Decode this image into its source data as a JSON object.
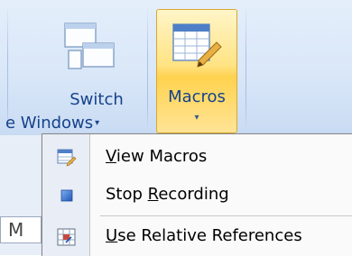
{
  "ribbon": {
    "switch_windows": {
      "line1": "Switch",
      "line2": "e Windows",
      "arrow": "▾"
    },
    "macros": {
      "label": "Macros",
      "arrow": "▾"
    }
  },
  "left_fragment": {
    "text": "M"
  },
  "menu": {
    "items": [
      {
        "pre": "",
        "mnemonic": "V",
        "post": "iew Macros",
        "icon": "view-macros-icon"
      },
      {
        "pre": "Stop ",
        "mnemonic": "R",
        "post": "ecording",
        "icon": "stop-recording-icon"
      },
      {
        "pre": "",
        "mnemonic": "U",
        "post": "se Relative References",
        "icon": "relative-references-icon"
      }
    ]
  },
  "colors": {
    "ribbon_text": "#15428b",
    "macros_highlight": "#ffd24f",
    "stop_square": "#2f6fd6"
  }
}
